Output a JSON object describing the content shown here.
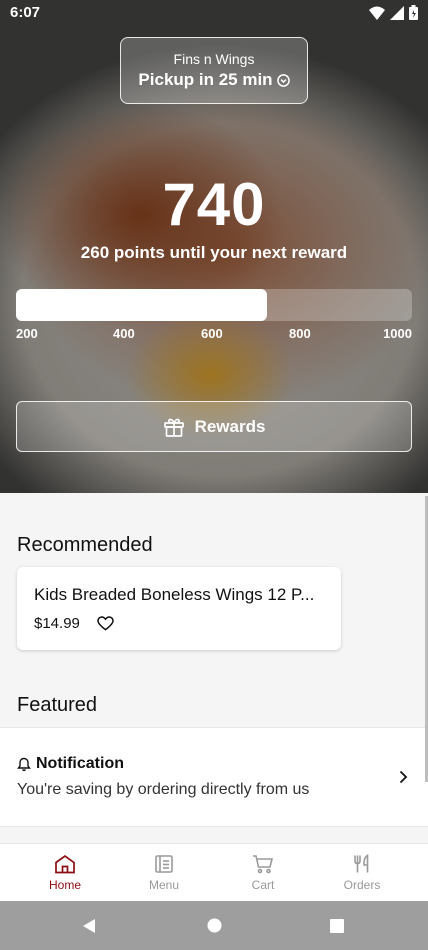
{
  "status_bar": {
    "time": "6:07"
  },
  "header": {
    "restaurant_name": "Fins n Wings",
    "pickup_label": "Pickup in 25 min"
  },
  "rewards": {
    "points": "740",
    "points_subtitle": "260 points until your next reward",
    "progress_fraction": 0.635,
    "tiers": [
      "200",
      "400",
      "600",
      "800",
      "1000"
    ],
    "button_label": "Rewards"
  },
  "recommended": {
    "title": "Recommended",
    "items": [
      {
        "name": "Kids Breaded Boneless Wings 12 P...",
        "price": "$14.99"
      }
    ]
  },
  "featured": {
    "title": "Featured",
    "notification_title": "Notification",
    "notification_body": "You're saving by ordering directly from us"
  },
  "nav": {
    "items": [
      {
        "label": "Home",
        "icon": "home-icon",
        "active": true
      },
      {
        "label": "Menu",
        "icon": "menu-icon",
        "active": false
      },
      {
        "label": "Cart",
        "icon": "cart-icon",
        "active": false
      },
      {
        "label": "Orders",
        "icon": "orders-icon",
        "active": false
      }
    ]
  },
  "colors": {
    "accent": "#8b0e12",
    "inactive": "#9a9a9a"
  }
}
